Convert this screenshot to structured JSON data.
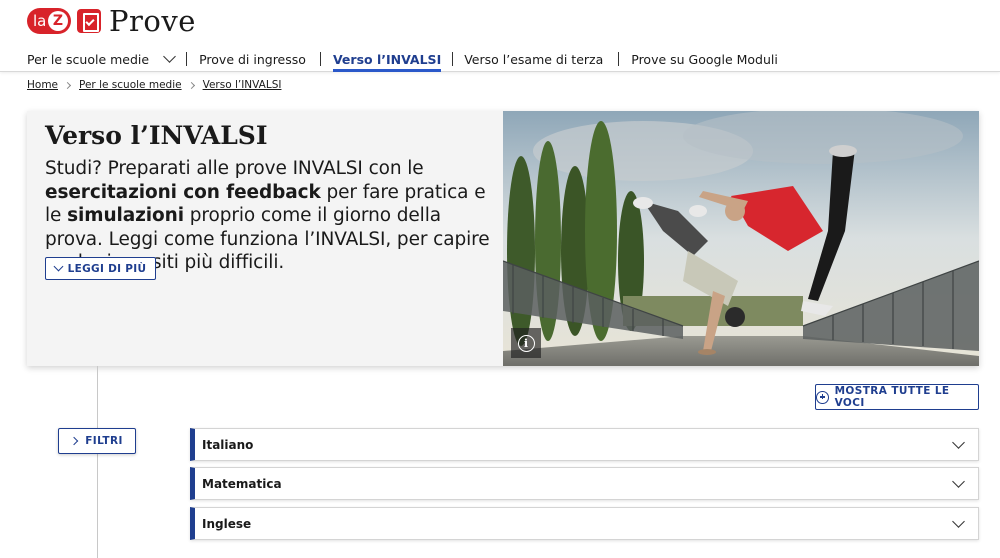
{
  "logo": {
    "la": "la",
    "z": "Z",
    "brand": "Prove"
  },
  "nav": {
    "items": [
      {
        "label": "Per le scuole medie"
      },
      {
        "label": "Prove di ingresso"
      },
      {
        "label": "Verso l’INVALSI"
      },
      {
        "label": "Verso l’esame di terza"
      },
      {
        "label": "Prove su Google Moduli"
      }
    ]
  },
  "breadcrumb": [
    "Home",
    "Per le scuole medie",
    "Verso l’INVALSI"
  ],
  "hero": {
    "title": "Verso l’INVALSI",
    "desc_1": "Studi? Preparati alle prove INVALSI con le ",
    "desc_b1": "esercitazioni con feedback",
    "desc_2": " per fare pratica e le ",
    "desc_b2": "simulazioni",
    "desc_3": " proprio come il giorno della prova. Leggi come funziona l’INVALSI, per capire anche i quesiti più difficili.",
    "more_label": "LEGGI DI PIÙ",
    "info_glyph": "i"
  },
  "actions": {
    "show_all": "MOSTRA TUTTE LE VOCI",
    "filters": "FILTRI"
  },
  "accordion": [
    {
      "label": "Italiano"
    },
    {
      "label": "Matematica"
    },
    {
      "label": "Inglese"
    }
  ],
  "colors": {
    "brand_red": "#d8232a",
    "accent_blue": "#1f3e8f",
    "active_underline": "#2a58c9"
  }
}
